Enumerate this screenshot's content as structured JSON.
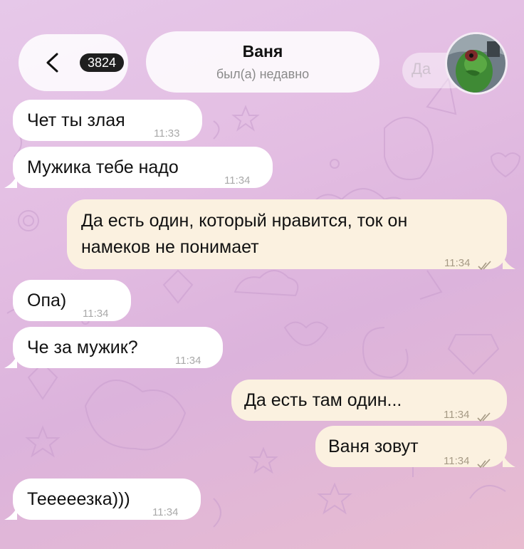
{
  "header": {
    "badge_count": "3824",
    "contact_name": "Ваня",
    "contact_status": "был(а) недавно",
    "ghost_text": "Да"
  },
  "messages": [
    {
      "direction": "in",
      "text": "Чет ты злая",
      "time": "11:33"
    },
    {
      "direction": "in",
      "text": "Мужика тебе надо",
      "time": "11:34"
    },
    {
      "direction": "out",
      "text_line1": "Да есть один, который нравится, ток он",
      "text_line2": "намеков не понимает",
      "time": "11:34",
      "read": true
    },
    {
      "direction": "in",
      "text": "Опа)",
      "time": "11:34"
    },
    {
      "direction": "in",
      "text": "Че за мужик?",
      "time": "11:34"
    },
    {
      "direction": "out",
      "text": "Да есть там один...",
      "time": "11:34",
      "read": true
    },
    {
      "direction": "out",
      "text": "Ваня зовут",
      "time": "11:34",
      "read": true
    },
    {
      "direction": "in",
      "text": "Тееееезка)))",
      "time": "11:34"
    }
  ],
  "colors": {
    "incoming_bubble": "#ffffff",
    "outgoing_bubble": "#fbf1e0",
    "badge": "#1f1f1f",
    "wallpaper": "#e3bde2"
  }
}
